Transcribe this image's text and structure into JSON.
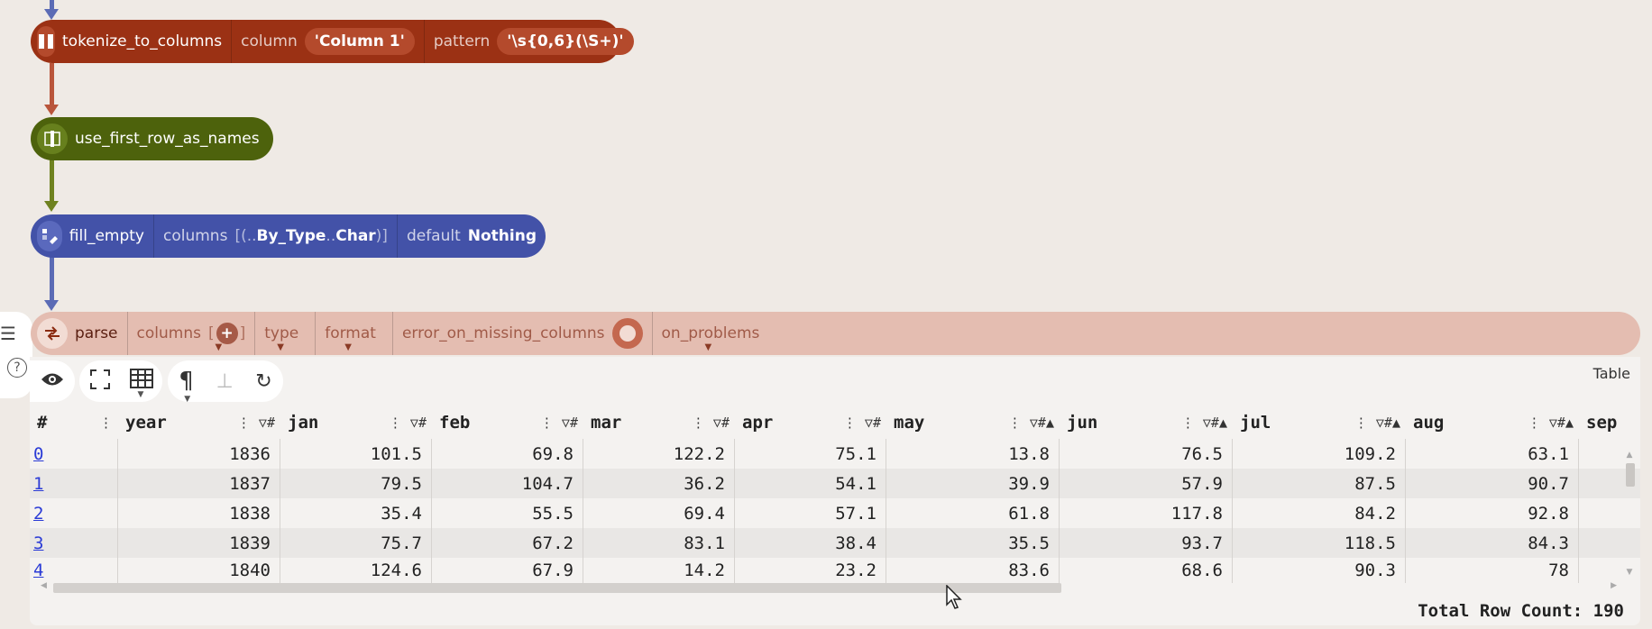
{
  "nodes": {
    "tokenize": {
      "name": "tokenize_to_columns",
      "arg1_label": "column",
      "arg1_value": "'Column 1'",
      "arg2_label": "pattern",
      "arg2_value": "'\\s{0,6}(\\S+)'",
      "color": "#9b3114"
    },
    "use_first": {
      "name": "use_first_row_as_names",
      "color": "#4d620c"
    },
    "fill_empty": {
      "name": "fill_empty",
      "arg1_label": "columns",
      "arg1_prefix": "[(..",
      "arg1_mid": "By_Type",
      "arg1_dots": " ..",
      "arg1_end": "Char",
      "arg1_close": ")]",
      "arg2_label": "default",
      "arg2_value": "Nothing",
      "color": "#4352a8"
    },
    "parse": {
      "name": "parse",
      "args": [
        "columns",
        "type",
        "format",
        "error_on_missing_columns",
        "on_problems"
      ],
      "columns_bracket_open": "[",
      "columns_bracket_close": "]",
      "color": "#e4bdb1"
    }
  },
  "viz": {
    "type_label": "Table",
    "total_row_count": "Total Row Count: 190"
  },
  "table": {
    "columns": [
      "#",
      "year",
      "jan",
      "feb",
      "mar",
      "apr",
      "may",
      "jun",
      "jul",
      "aug",
      "sep"
    ],
    "header_icons": [
      "⋮",
      "⋮ ▽#",
      "⋮ ▽#",
      "⋮ ▽#",
      "⋮ ▽#",
      "⋮ ▽#",
      "⋮ ▽#▲",
      "⋮ ▽#▲",
      "⋮ ▽#▲",
      "⋮ ▽#▲",
      ""
    ],
    "rows": [
      [
        "0",
        "1836",
        "101.5",
        "69.8",
        "122.2",
        "75.1",
        "13.8",
        "76.5",
        "109.2",
        "63.1"
      ],
      [
        "1",
        "1837",
        "79.5",
        "104.7",
        "36.2",
        "54.1",
        "39.9",
        "57.9",
        "87.5",
        "90.7"
      ],
      [
        "2",
        "1838",
        "35.4",
        "55.5",
        "69.4",
        "57.1",
        "61.8",
        "117.8",
        "84.2",
        "92.8"
      ],
      [
        "3",
        "1839",
        "75.7",
        "67.2",
        "83.1",
        "38.4",
        "35.5",
        "93.7",
        "118.5",
        "84.3"
      ],
      [
        "4",
        "1840",
        "124.6",
        "67.9",
        "14.2",
        "23.2",
        "83.6",
        "68.6",
        "90.3",
        "78"
      ]
    ]
  }
}
